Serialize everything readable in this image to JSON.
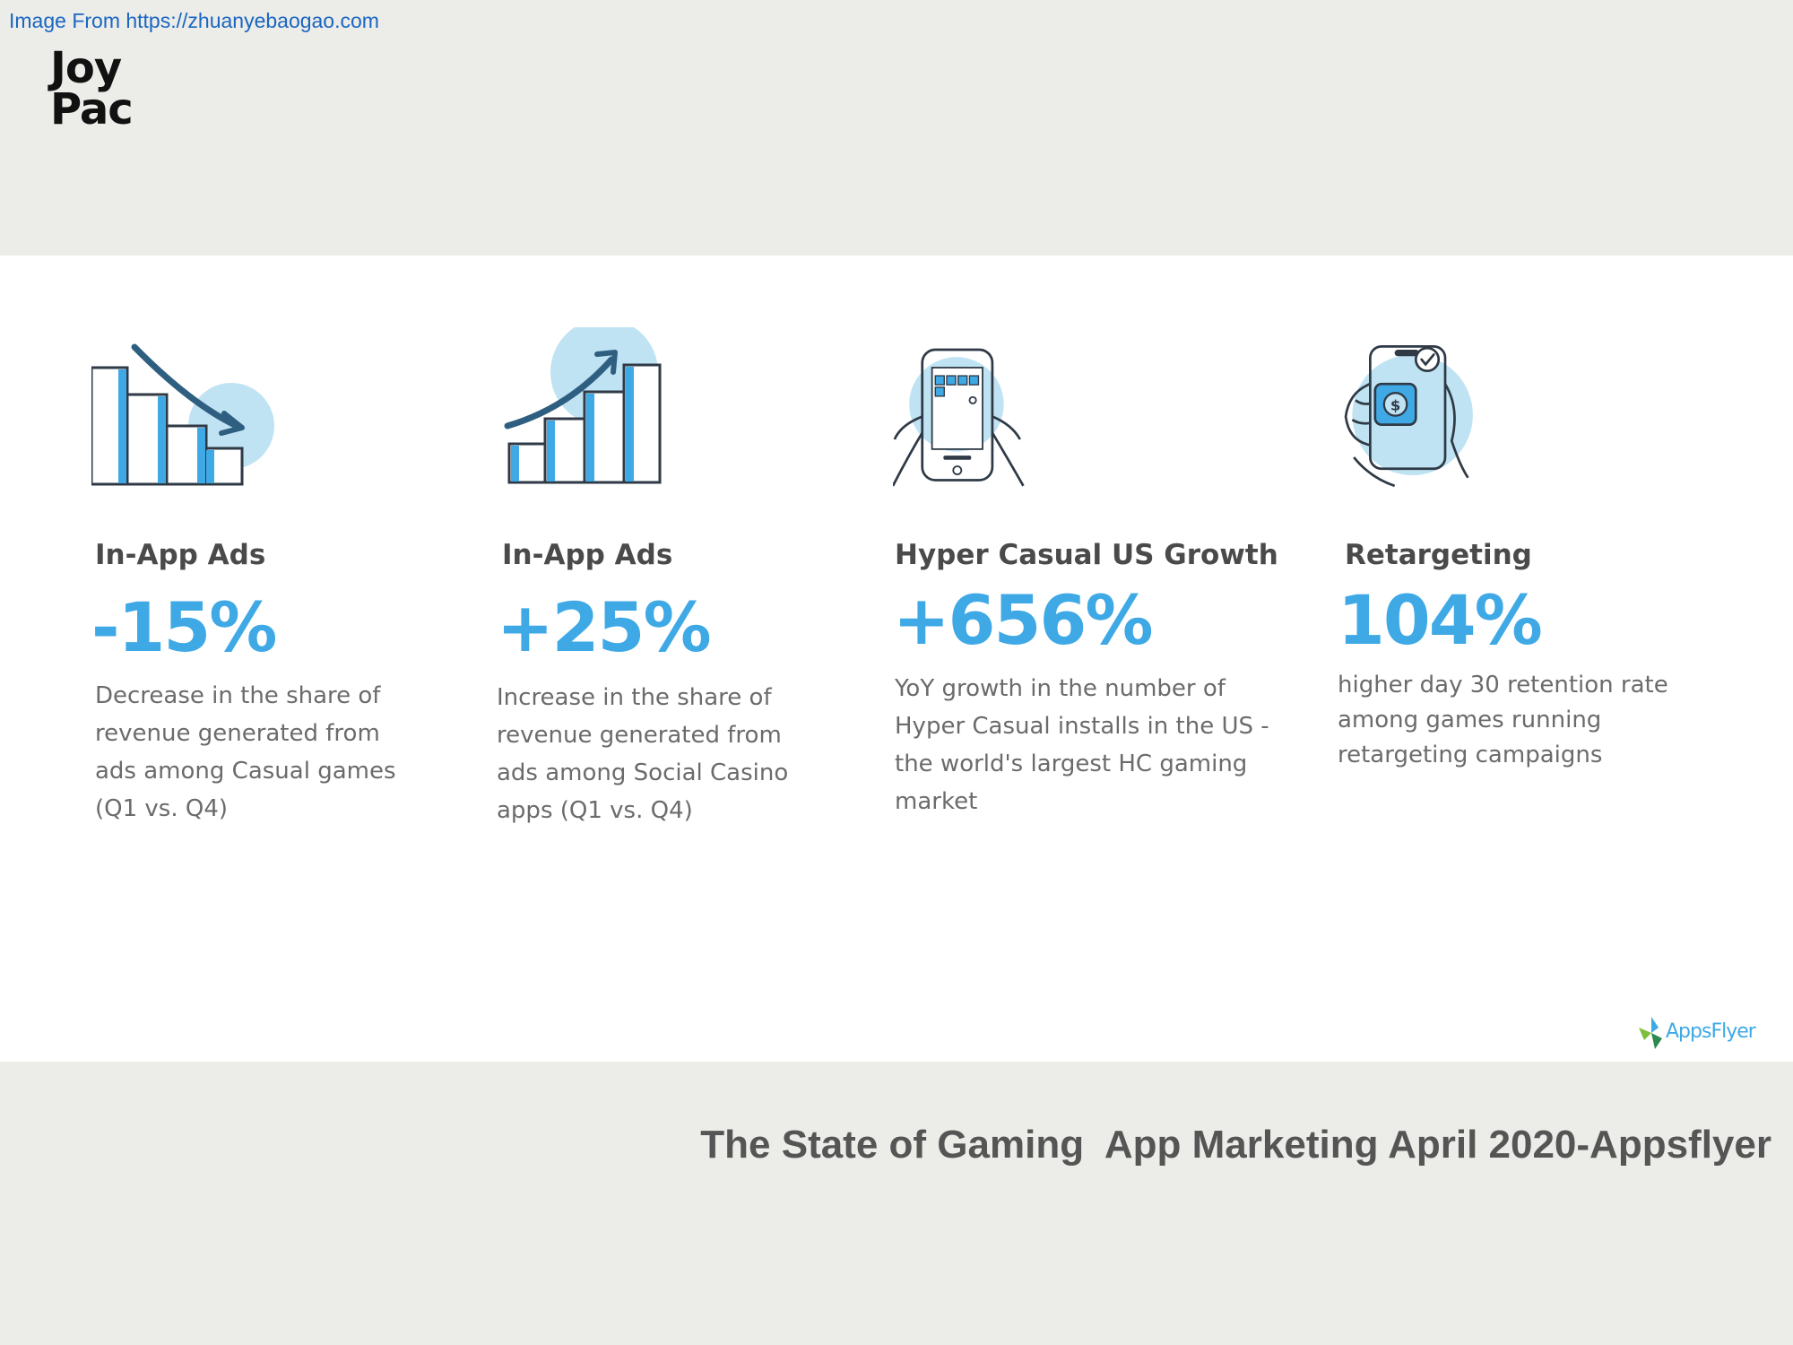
{
  "source": {
    "text": "Image From https://zhuanyebaogao.com"
  },
  "logo": {
    "line1": "Joy",
    "line2": "Pac"
  },
  "stats": [
    {
      "icon": "bar-chart-down-icon",
      "heading": "In-App Ads",
      "value": "-15%",
      "description": "Decrease in the share of revenue generated from ads among Casual games (Q1 vs. Q4)"
    },
    {
      "icon": "bar-chart-up-icon",
      "heading": "In-App Ads",
      "value": "+25%",
      "description": "Increase in the share of revenue generated from ads among Social Casino apps (Q1 vs. Q4)"
    },
    {
      "icon": "phone-hands-icon",
      "heading": "Hyper Casual US Growth",
      "value": "+656%",
      "description": "YoY growth in the number of Hyper Casual installs in the US - the world's largest HC gaming market"
    },
    {
      "icon": "phone-dollar-icon",
      "heading": "Retargeting",
      "value": "104%",
      "description": "higher day 30 retention rate among games running retargeting campaigns"
    }
  ],
  "brand": {
    "name": "AppsFlyer"
  },
  "footer": {
    "title": "The State of Gaming  App Marketing April 2020-Appsflyer"
  },
  "colors": {
    "accent": "#3fa9e6",
    "background": "#ecece8",
    "panel": "#ffffff"
  }
}
